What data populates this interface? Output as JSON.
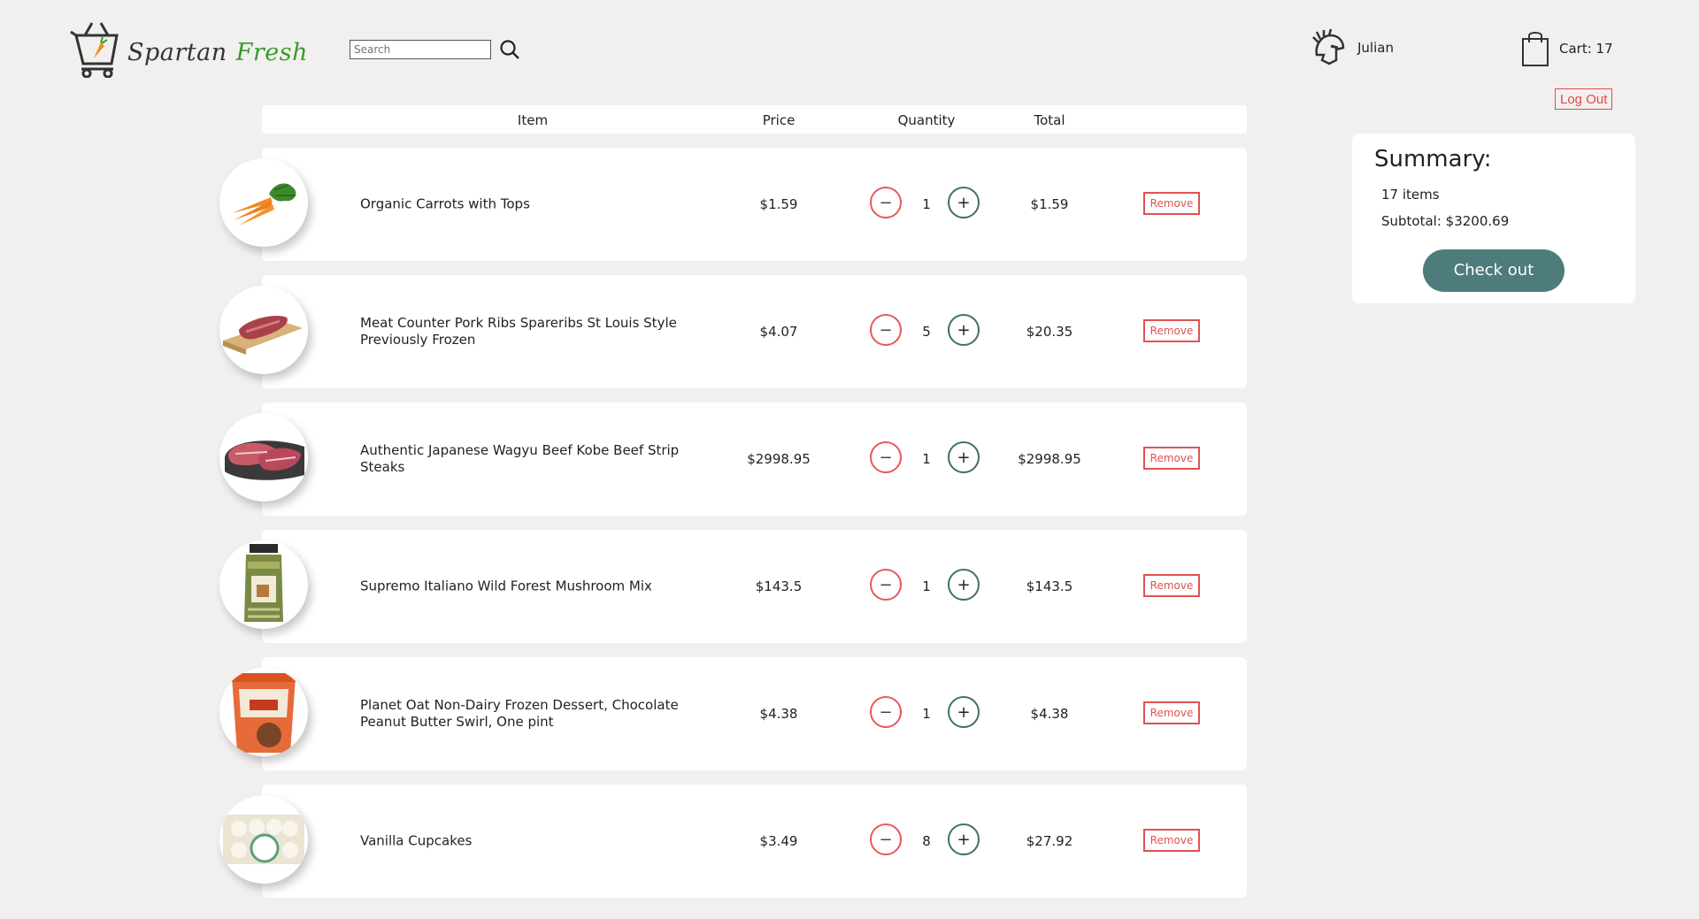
{
  "header": {
    "logo_word1": "Spartan",
    "logo_word2": "Fresh",
    "search_placeholder": "Search",
    "user_name": "Julian",
    "cart_label": "Cart: 17",
    "logout_label": "Log Out"
  },
  "table": {
    "columns": {
      "item": "Item",
      "price": "Price",
      "quantity": "Quantity",
      "total": "Total"
    },
    "rows": [
      {
        "name": "Organic Carrots with Tops",
        "price": "$1.59",
        "qty": "1",
        "total": "$1.59",
        "image_icon": "carrots-image",
        "remove_label": "Remove",
        "minus": "−",
        "plus": "+"
      },
      {
        "name": "Meat Counter Pork Ribs Spareribs St Louis Style Previously Frozen",
        "price": "$4.07",
        "qty": "5",
        "total": "$20.35",
        "image_icon": "pork-ribs-image",
        "remove_label": "Remove",
        "minus": "−",
        "plus": "+"
      },
      {
        "name": "Authentic Japanese Wagyu Beef Kobe Beef Strip Steaks",
        "price": "$2998.95",
        "qty": "1",
        "total": "$2998.95",
        "image_icon": "wagyu-steak-image",
        "remove_label": "Remove",
        "minus": "−",
        "plus": "+"
      },
      {
        "name": "Supremo Italiano Wild Forest Mushroom Mix",
        "price": "$143.5",
        "qty": "1",
        "total": "$143.5",
        "image_icon": "mushroom-jar-image",
        "remove_label": "Remove",
        "minus": "−",
        "plus": "+"
      },
      {
        "name": "Planet Oat Non-Dairy Frozen Dessert, Chocolate Peanut Butter Swirl, One pint",
        "price": "$4.38",
        "qty": "1",
        "total": "$4.38",
        "image_icon": "ice-cream-pint-image",
        "remove_label": "Remove",
        "minus": "−",
        "plus": "+"
      },
      {
        "name": "Vanilla Cupcakes",
        "price": "$3.49",
        "qty": "8",
        "total": "$27.92",
        "image_icon": "cupcakes-box-image",
        "remove_label": "Remove",
        "minus": "−",
        "plus": "+"
      }
    ]
  },
  "summary": {
    "title": "Summary:",
    "item_count": "17 items",
    "subtotal": "Subtotal: $3200.69",
    "checkout_label": "Check out"
  },
  "colors": {
    "background": "#f2f0ee",
    "accent_teal": "#4e7b7b",
    "remove_red": "#e05252",
    "logo_green": "#3a9a2e"
  }
}
